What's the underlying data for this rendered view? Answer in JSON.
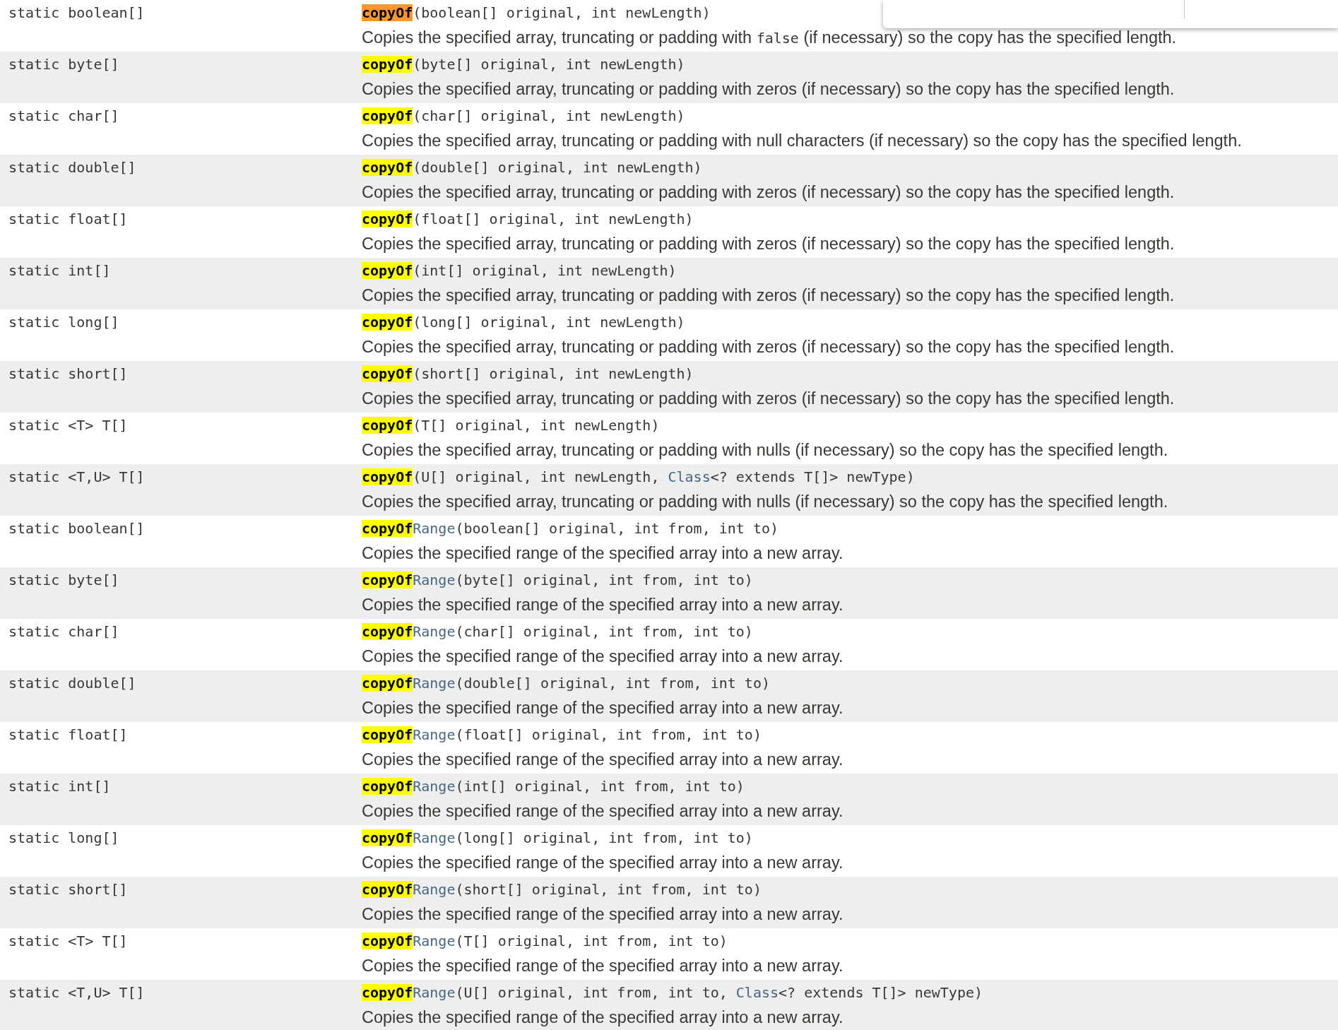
{
  "rows": [
    {
      "modifier": "static boolean[]",
      "match": "copyOf",
      "current_match": true,
      "name_rest": "",
      "params": [
        {
          "kind": "text",
          "text": "(boolean[] original, int newLength)"
        }
      ],
      "description": [
        {
          "kind": "text",
          "text": "Copies the specified array, truncating or padding with "
        },
        {
          "kind": "code",
          "text": "false"
        },
        {
          "kind": "text",
          "text": " (if necessary) so the copy has the specified length."
        }
      ]
    },
    {
      "modifier": "static byte[]",
      "match": "copyOf",
      "current_match": false,
      "name_rest": "",
      "params": [
        {
          "kind": "text",
          "text": "(byte[] original, int newLength)"
        }
      ],
      "description": [
        {
          "kind": "text",
          "text": "Copies the specified array, truncating or padding with zeros (if necessary) so the copy has the specified length."
        }
      ]
    },
    {
      "modifier": "static char[]",
      "match": "copyOf",
      "current_match": false,
      "name_rest": "",
      "params": [
        {
          "kind": "text",
          "text": "(char[] original, int newLength)"
        }
      ],
      "description": [
        {
          "kind": "text",
          "text": "Copies the specified array, truncating or padding with null characters (if necessary) so the copy has the specified length."
        }
      ]
    },
    {
      "modifier": "static double[]",
      "match": "copyOf",
      "current_match": false,
      "name_rest": "",
      "params": [
        {
          "kind": "text",
          "text": "(double[] original, int newLength)"
        }
      ],
      "description": [
        {
          "kind": "text",
          "text": "Copies the specified array, truncating or padding with zeros (if necessary) so the copy has the specified length."
        }
      ]
    },
    {
      "modifier": "static float[]",
      "match": "copyOf",
      "current_match": false,
      "name_rest": "",
      "params": [
        {
          "kind": "text",
          "text": "(float[] original, int newLength)"
        }
      ],
      "description": [
        {
          "kind": "text",
          "text": "Copies the specified array, truncating or padding with zeros (if necessary) so the copy has the specified length."
        }
      ]
    },
    {
      "modifier": "static int[]",
      "match": "copyOf",
      "current_match": false,
      "name_rest": "",
      "params": [
        {
          "kind": "text",
          "text": "(int[] original, int newLength)"
        }
      ],
      "description": [
        {
          "kind": "text",
          "text": "Copies the specified array, truncating or padding with zeros (if necessary) so the copy has the specified length."
        }
      ]
    },
    {
      "modifier": "static long[]",
      "match": "copyOf",
      "current_match": false,
      "name_rest": "",
      "params": [
        {
          "kind": "text",
          "text": "(long[] original, int newLength)"
        }
      ],
      "description": [
        {
          "kind": "text",
          "text": "Copies the specified array, truncating or padding with zeros (if necessary) so the copy has the specified length."
        }
      ]
    },
    {
      "modifier": "static short[]",
      "match": "copyOf",
      "current_match": false,
      "name_rest": "",
      "params": [
        {
          "kind": "text",
          "text": "(short[] original, int newLength)"
        }
      ],
      "description": [
        {
          "kind": "text",
          "text": "Copies the specified array, truncating or padding with zeros (if necessary) so the copy has the specified length."
        }
      ]
    },
    {
      "modifier": "static <T> T[]",
      "match": "copyOf",
      "current_match": false,
      "name_rest": "",
      "params": [
        {
          "kind": "text",
          "text": "(T[] original, int newLength)"
        }
      ],
      "description": [
        {
          "kind": "text",
          "text": "Copies the specified array, truncating or padding with nulls (if necessary) so the copy has the specified length."
        }
      ]
    },
    {
      "modifier": "static <T,U> T[]",
      "match": "copyOf",
      "current_match": false,
      "name_rest": "",
      "params": [
        {
          "kind": "text",
          "text": "(U[] original, int newLength, "
        },
        {
          "kind": "link",
          "text": "Class"
        },
        {
          "kind": "text",
          "text": "<? extends T[]> newType)"
        }
      ],
      "description": [
        {
          "kind": "text",
          "text": "Copies the specified array, truncating or padding with nulls (if necessary) so the copy has the specified length."
        }
      ]
    },
    {
      "modifier": "static boolean[]",
      "match": "copyOf",
      "current_match": false,
      "name_rest": "Range",
      "params": [
        {
          "kind": "text",
          "text": "(boolean[] original, int from, int to)"
        }
      ],
      "description": [
        {
          "kind": "text",
          "text": "Copies the specified range of the specified array into a new array."
        }
      ]
    },
    {
      "modifier": "static byte[]",
      "match": "copyOf",
      "current_match": false,
      "name_rest": "Range",
      "params": [
        {
          "kind": "text",
          "text": "(byte[] original, int from, int to)"
        }
      ],
      "description": [
        {
          "kind": "text",
          "text": "Copies the specified range of the specified array into a new array."
        }
      ]
    },
    {
      "modifier": "static char[]",
      "match": "copyOf",
      "current_match": false,
      "name_rest": "Range",
      "params": [
        {
          "kind": "text",
          "text": "(char[] original, int from, int to)"
        }
      ],
      "description": [
        {
          "kind": "text",
          "text": "Copies the specified range of the specified array into a new array."
        }
      ]
    },
    {
      "modifier": "static double[]",
      "match": "copyOf",
      "current_match": false,
      "name_rest": "Range",
      "params": [
        {
          "kind": "text",
          "text": "(double[] original, int from, int to)"
        }
      ],
      "description": [
        {
          "kind": "text",
          "text": "Copies the specified range of the specified array into a new array."
        }
      ]
    },
    {
      "modifier": "static float[]",
      "match": "copyOf",
      "current_match": false,
      "name_rest": "Range",
      "params": [
        {
          "kind": "text",
          "text": "(float[] original, int from, int to)"
        }
      ],
      "description": [
        {
          "kind": "text",
          "text": "Copies the specified range of the specified array into a new array."
        }
      ]
    },
    {
      "modifier": "static int[]",
      "match": "copyOf",
      "current_match": false,
      "name_rest": "Range",
      "params": [
        {
          "kind": "text",
          "text": "(int[] original, int from, int to)"
        }
      ],
      "description": [
        {
          "kind": "text",
          "text": "Copies the specified range of the specified array into a new array."
        }
      ]
    },
    {
      "modifier": "static long[]",
      "match": "copyOf",
      "current_match": false,
      "name_rest": "Range",
      "params": [
        {
          "kind": "text",
          "text": "(long[] original, int from, int to)"
        }
      ],
      "description": [
        {
          "kind": "text",
          "text": "Copies the specified range of the specified array into a new array."
        }
      ]
    },
    {
      "modifier": "static short[]",
      "match": "copyOf",
      "current_match": false,
      "name_rest": "Range",
      "params": [
        {
          "kind": "text",
          "text": "(short[] original, int from, int to)"
        }
      ],
      "description": [
        {
          "kind": "text",
          "text": "Copies the specified range of the specified array into a new array."
        }
      ]
    },
    {
      "modifier": "static <T> T[]",
      "match": "copyOf",
      "current_match": false,
      "name_rest": "Range",
      "params": [
        {
          "kind": "text",
          "text": "(T[] original, int from, int to)"
        }
      ],
      "description": [
        {
          "kind": "text",
          "text": "Copies the specified range of the specified array into a new array."
        }
      ]
    },
    {
      "modifier": "static <T,U> T[]",
      "match": "copyOf",
      "current_match": false,
      "name_rest": "Range",
      "params": [
        {
          "kind": "text",
          "text": "(U[] original, int from, int to, "
        },
        {
          "kind": "link",
          "text": "Class"
        },
        {
          "kind": "text",
          "text": "<? extends T[]> newType)"
        }
      ],
      "description": [
        {
          "kind": "text",
          "text": "Copies the specified range of the specified array into a new array."
        }
      ]
    }
  ]
}
